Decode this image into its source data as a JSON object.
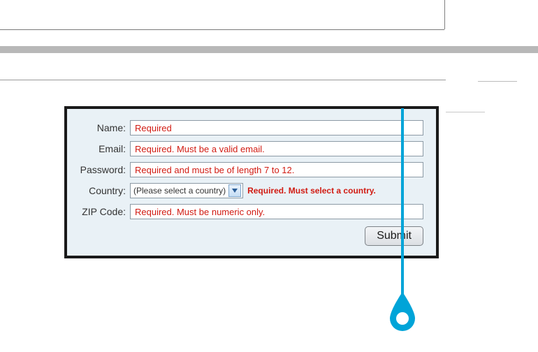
{
  "form": {
    "fields": {
      "name": {
        "label": "Name:",
        "value": "Required"
      },
      "email": {
        "label": "Email:",
        "value": "Required. Must be a valid email."
      },
      "password": {
        "label": "Password:",
        "value": "Required and must be of length 7 to 12."
      },
      "country": {
        "label": "Country:",
        "selected": "(Please select a country)",
        "error": "Required. Must select a country."
      },
      "zip": {
        "label": "ZIP Code:",
        "value": "Required. Must be numeric only."
      }
    },
    "submit_label": "Submit"
  },
  "colors": {
    "error": "#d11b12",
    "accent": "#00a4d8",
    "panel_bg": "#e9f1f6",
    "panel_border": "#1a1a1a"
  }
}
